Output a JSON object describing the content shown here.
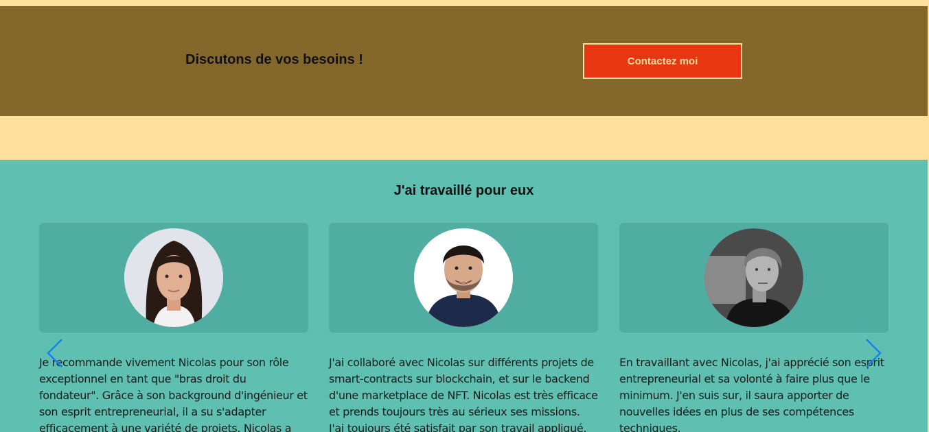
{
  "cta": {
    "title": "Discutons de vos besoins !",
    "button_label": "Contactez moi"
  },
  "testimonials": {
    "title": "J'ai travaillé pour eux",
    "cards": [
      {
        "avatar": "woman-portrait",
        "quote": "Je recommande vivement Nicolas pour son rôle exceptionnel en tant que \"bras droit du fondateur\". Grâce à son background d'ingénieur et son esprit entrepreneurial, il a su s'adapter efficacement à une variété de projets. Nicolas a montré une grande"
      },
      {
        "avatar": "man-smiling-portrait",
        "quote": "J'ai collaboré avec Nicolas sur différents projets de smart-contracts sur blockchain, et sur le backend d'une marketplace de NFT. Nicolas est très efficace et prends toujours très au sérieux ses missions. J'ai toujours été satisfait par son travail appliqué."
      },
      {
        "avatar": "man-bw-portrait",
        "quote": "En travaillant avec Nicolas, j'ai apprécié son esprit entrepreneurial et sa volonté à faire plus que le minimum. J'en suis sur, il saura apporter de nouvelles idées en plus de ses compétences techniques."
      }
    ],
    "prev_icon": "chevron-left-icon",
    "next_icon": "chevron-right-icon"
  },
  "colors": {
    "cream": "#fde09b",
    "brown_band": "#83672b",
    "button_red": "#e83612",
    "teal": "#5fbfb1",
    "card_teal": "#50ada1",
    "arrow_blue": "#1a7fe8"
  }
}
